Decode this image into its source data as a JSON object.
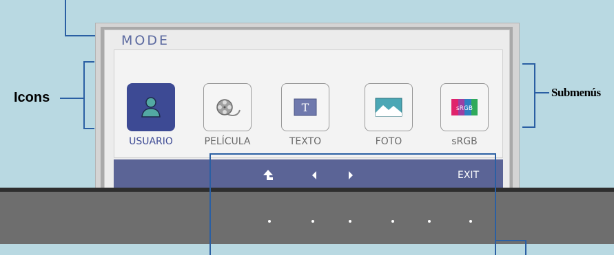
{
  "osd": {
    "title": "MODE",
    "options": [
      {
        "label": "USUARIO",
        "icon": "user-icon",
        "active": true
      },
      {
        "label": "PELÍCULA",
        "icon": "film-reel-icon",
        "active": false
      },
      {
        "label": "TEXTO",
        "icon": "text-icon",
        "active": false
      },
      {
        "label": "FOTO",
        "icon": "landscape-photo-icon",
        "active": false
      },
      {
        "label": "sRGB",
        "icon": "srgb-icon",
        "active": false,
        "badge": "sRGB"
      }
    ],
    "nav": {
      "exit_label": "EXIT",
      "buttons": [
        "up-arrow-icon",
        "left-arrow-icon",
        "right-arrow-icon"
      ]
    }
  },
  "annotations": {
    "left_label": "Icons",
    "right_label": "Submenús"
  },
  "colors": {
    "background": "#b9d9e2",
    "accent": "#3d4a94",
    "navbar": "#5b6496",
    "callout_line": "#2a5fa3"
  }
}
